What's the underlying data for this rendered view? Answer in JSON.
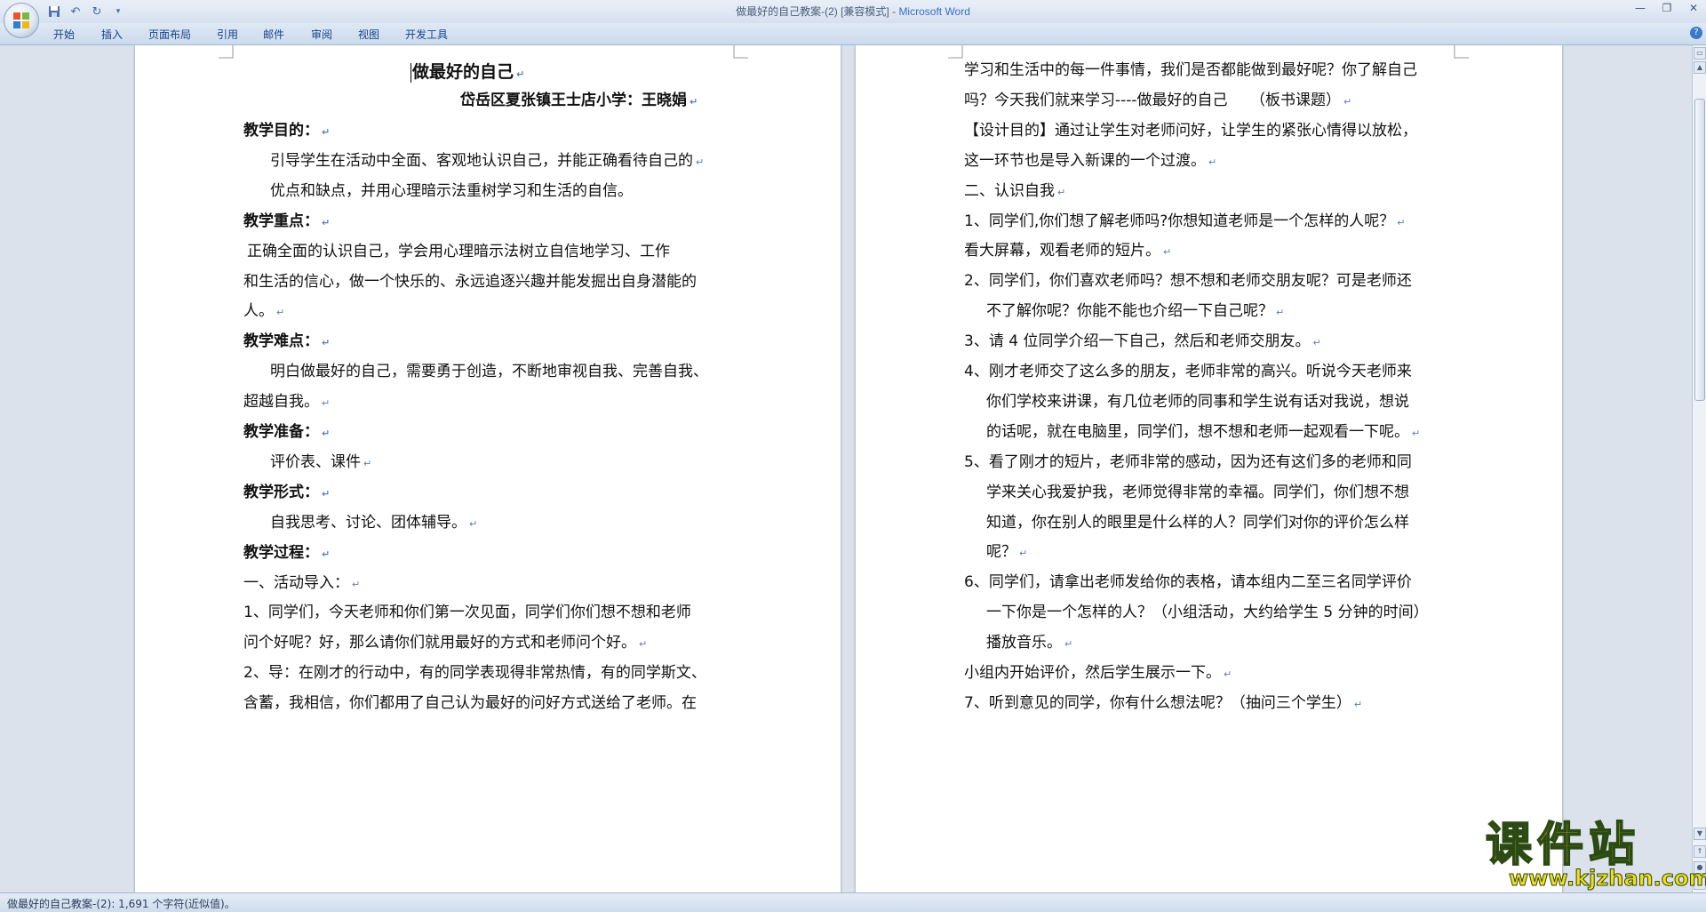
{
  "window": {
    "title_doc": "做最好的自己教案-(2) [兼容模式] - ",
    "title_app": "Microsoft Word"
  },
  "qat": {
    "save_icon": "save-icon",
    "undo_icon": "undo-icon",
    "redo_icon": "redo-icon",
    "more_icon": "customize-icon"
  },
  "ribbon": {
    "tabs": [
      "开始",
      "插入",
      "页面布局",
      "引用",
      "邮件",
      "审阅",
      "视图",
      "开发工具"
    ],
    "help_label": "?"
  },
  "window_controls": {
    "minimize": "—",
    "restore": "❐",
    "close": "✕"
  },
  "left_page": {
    "title": "做最好的自己",
    "author": "岱岳区夏张镇王士店小学：王晓娟",
    "lines": [
      "教学目的：",
      "引导学生在活动中全面、客观地认识自己，并能正确看待自己的",
      "优点和缺点，并用心理暗示法重树学习和生活的自信。",
      "教学重点：",
      "正确全面的认识自己，学会用心理暗示法树立自信地学习、工作",
      "和生活的信心，做一个快乐的、永远追逐兴趣并能发掘出自身潜能的",
      "人。",
      "教学难点：",
      "明白做最好的自己，需要勇于创造，不断地审视自我、完善自我、",
      "超越自我。",
      "教学准备：",
      "评价表、课件",
      "教学形式：",
      "自我思考、讨论、团体辅导。",
      "教学过程：",
      "一、活动导入：",
      "1、同学们，今天老师和你们第一次见面，同学们你们想不想和老师",
      "问个好呢？好，那么请你们就用最好的方式和老师问个好。",
      "2、导：在刚才的行动中，有的同学表现得非常热情，有的同学斯文、",
      "含蓄，我相信，你们都用了自己认为最好的问好方式送给了老师。在"
    ]
  },
  "right_page": {
    "lines": [
      "学习和生活中的每一件事情，我们是否都能做到最好呢？你了解自己",
      "吗？今天我们就来学习----做最好的自己　　（板书课题）",
      "【设计目的】通过让学生对老师问好，让学生的紧张心情得以放松，",
      "这一环节也是导入新课的一个过渡。",
      "二、认识自我",
      "1、同学们,你们想了解老师吗?你想知道老师是一个怎样的人呢？",
      "看大屏幕，观看老师的短片。",
      "2、同学们，你们喜欢老师吗？想不想和老师交朋友呢？可是老师还",
      "不了解你呢？你能不能也介绍一下自己呢？",
      "3、请 4 位同学介绍一下自己，然后和老师交朋友。",
      "4、刚才老师交了这么多的朋友，老师非常的高兴。听说今天老师来",
      "你们学校来讲课，有几位老师的同事和学生说有话对我说，想说",
      "的话呢，就在电脑里，同学们，想不想和老师一起观看一下呢。",
      "5、看了刚才的短片，老师非常的感动，因为还有这们多的老师和同",
      "学来关心我爱护我，老师觉得非常的幸福。同学们，你们想不想",
      "知道，你在别人的眼里是什么样的人？同学们对你的评价怎么样",
      "呢？",
      "6、同学们，请拿出老师发给你的表格，请本组内二至三名同学评价",
      "一下你是一个怎样的人？（小组活动，大约给学生 5 分钟的时间）",
      "播放音乐。",
      "小组内开始评价，然后学生展示一下。",
      "7、听到意见的同学，你有什么想法呢？（抽问三个学生）"
    ]
  },
  "paragraph_mark": "↵",
  "statusbar": {
    "text": "做最好的自己教案-(2): 1,691 个字符(近似值)。"
  },
  "watermark": {
    "main": "课件站",
    "url": "www.kjzhan.com"
  },
  "colors": {
    "accent": "#15428b",
    "watermark_fill": "#f3dc1a",
    "watermark_stroke": "#2b4a14"
  }
}
